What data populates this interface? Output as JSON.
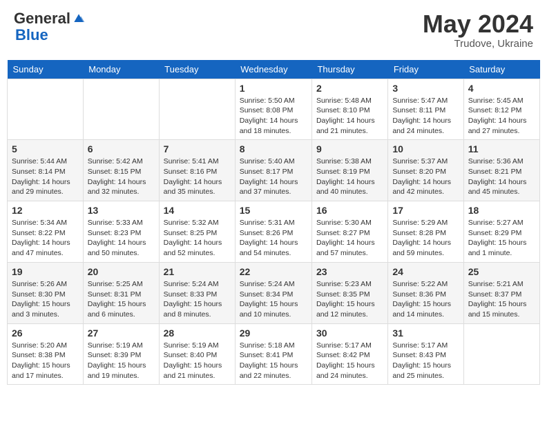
{
  "header": {
    "logo_general": "General",
    "logo_blue": "Blue",
    "month": "May 2024",
    "location": "Trudove, Ukraine"
  },
  "days_of_week": [
    "Sunday",
    "Monday",
    "Tuesday",
    "Wednesday",
    "Thursday",
    "Friday",
    "Saturday"
  ],
  "weeks": [
    [
      {
        "day": "",
        "info": ""
      },
      {
        "day": "",
        "info": ""
      },
      {
        "day": "",
        "info": ""
      },
      {
        "day": "1",
        "info": "Sunrise: 5:50 AM\nSunset: 8:08 PM\nDaylight: 14 hours\nand 18 minutes."
      },
      {
        "day": "2",
        "info": "Sunrise: 5:48 AM\nSunset: 8:10 PM\nDaylight: 14 hours\nand 21 minutes."
      },
      {
        "day": "3",
        "info": "Sunrise: 5:47 AM\nSunset: 8:11 PM\nDaylight: 14 hours\nand 24 minutes."
      },
      {
        "day": "4",
        "info": "Sunrise: 5:45 AM\nSunset: 8:12 PM\nDaylight: 14 hours\nand 27 minutes."
      }
    ],
    [
      {
        "day": "5",
        "info": "Sunrise: 5:44 AM\nSunset: 8:14 PM\nDaylight: 14 hours\nand 29 minutes."
      },
      {
        "day": "6",
        "info": "Sunrise: 5:42 AM\nSunset: 8:15 PM\nDaylight: 14 hours\nand 32 minutes."
      },
      {
        "day": "7",
        "info": "Sunrise: 5:41 AM\nSunset: 8:16 PM\nDaylight: 14 hours\nand 35 minutes."
      },
      {
        "day": "8",
        "info": "Sunrise: 5:40 AM\nSunset: 8:17 PM\nDaylight: 14 hours\nand 37 minutes."
      },
      {
        "day": "9",
        "info": "Sunrise: 5:38 AM\nSunset: 8:19 PM\nDaylight: 14 hours\nand 40 minutes."
      },
      {
        "day": "10",
        "info": "Sunrise: 5:37 AM\nSunset: 8:20 PM\nDaylight: 14 hours\nand 42 minutes."
      },
      {
        "day": "11",
        "info": "Sunrise: 5:36 AM\nSunset: 8:21 PM\nDaylight: 14 hours\nand 45 minutes."
      }
    ],
    [
      {
        "day": "12",
        "info": "Sunrise: 5:34 AM\nSunset: 8:22 PM\nDaylight: 14 hours\nand 47 minutes."
      },
      {
        "day": "13",
        "info": "Sunrise: 5:33 AM\nSunset: 8:23 PM\nDaylight: 14 hours\nand 50 minutes."
      },
      {
        "day": "14",
        "info": "Sunrise: 5:32 AM\nSunset: 8:25 PM\nDaylight: 14 hours\nand 52 minutes."
      },
      {
        "day": "15",
        "info": "Sunrise: 5:31 AM\nSunset: 8:26 PM\nDaylight: 14 hours\nand 54 minutes."
      },
      {
        "day": "16",
        "info": "Sunrise: 5:30 AM\nSunset: 8:27 PM\nDaylight: 14 hours\nand 57 minutes."
      },
      {
        "day": "17",
        "info": "Sunrise: 5:29 AM\nSunset: 8:28 PM\nDaylight: 14 hours\nand 59 minutes."
      },
      {
        "day": "18",
        "info": "Sunrise: 5:27 AM\nSunset: 8:29 PM\nDaylight: 15 hours\nand 1 minute."
      }
    ],
    [
      {
        "day": "19",
        "info": "Sunrise: 5:26 AM\nSunset: 8:30 PM\nDaylight: 15 hours\nand 3 minutes."
      },
      {
        "day": "20",
        "info": "Sunrise: 5:25 AM\nSunset: 8:31 PM\nDaylight: 15 hours\nand 6 minutes."
      },
      {
        "day": "21",
        "info": "Sunrise: 5:24 AM\nSunset: 8:33 PM\nDaylight: 15 hours\nand 8 minutes."
      },
      {
        "day": "22",
        "info": "Sunrise: 5:24 AM\nSunset: 8:34 PM\nDaylight: 15 hours\nand 10 minutes."
      },
      {
        "day": "23",
        "info": "Sunrise: 5:23 AM\nSunset: 8:35 PM\nDaylight: 15 hours\nand 12 minutes."
      },
      {
        "day": "24",
        "info": "Sunrise: 5:22 AM\nSunset: 8:36 PM\nDaylight: 15 hours\nand 14 minutes."
      },
      {
        "day": "25",
        "info": "Sunrise: 5:21 AM\nSunset: 8:37 PM\nDaylight: 15 hours\nand 15 minutes."
      }
    ],
    [
      {
        "day": "26",
        "info": "Sunrise: 5:20 AM\nSunset: 8:38 PM\nDaylight: 15 hours\nand 17 minutes."
      },
      {
        "day": "27",
        "info": "Sunrise: 5:19 AM\nSunset: 8:39 PM\nDaylight: 15 hours\nand 19 minutes."
      },
      {
        "day": "28",
        "info": "Sunrise: 5:19 AM\nSunset: 8:40 PM\nDaylight: 15 hours\nand 21 minutes."
      },
      {
        "day": "29",
        "info": "Sunrise: 5:18 AM\nSunset: 8:41 PM\nDaylight: 15 hours\nand 22 minutes."
      },
      {
        "day": "30",
        "info": "Sunrise: 5:17 AM\nSunset: 8:42 PM\nDaylight: 15 hours\nand 24 minutes."
      },
      {
        "day": "31",
        "info": "Sunrise: 5:17 AM\nSunset: 8:43 PM\nDaylight: 15 hours\nand 25 minutes."
      },
      {
        "day": "",
        "info": ""
      }
    ]
  ]
}
